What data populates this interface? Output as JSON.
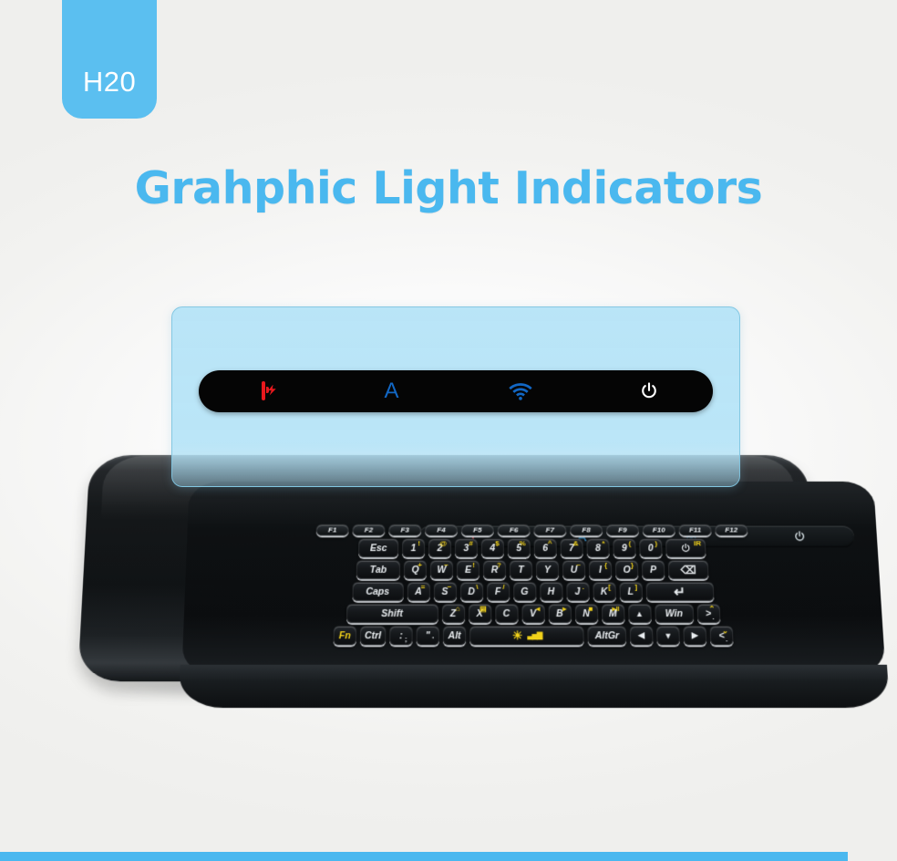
{
  "page": {
    "background": "#f4f4f2",
    "accent": "#4ab8ef",
    "badge_color": "#5bbff0"
  },
  "badge": {
    "label": "H20"
  },
  "heading": {
    "title": "Grahphic Light Indicators",
    "color": "#4ab8ef"
  },
  "indicators": {
    "items": [
      {
        "name": "battery-charging-icon",
        "label": "Battery Charging",
        "color": "#e8181d",
        "type": "battery"
      },
      {
        "name": "caps-lock-icon",
        "label": "A",
        "color": "#1267c4",
        "type": "caps"
      },
      {
        "name": "wifi-icon",
        "label": "Wi-Fi",
        "color": "#1267c4",
        "type": "wifi"
      },
      {
        "name": "power-icon",
        "label": "Power",
        "color": "#ffffff",
        "type": "power"
      }
    ],
    "strip_items": [
      {
        "name": "battery-charging-icon",
        "color": "#d4565e",
        "type": "battery"
      },
      {
        "name": "caps-lock-icon",
        "label": "A",
        "color": "#3f9ad4",
        "type": "caps"
      },
      {
        "name": "wifi-icon",
        "color": "#3f9ad4",
        "type": "wifi"
      },
      {
        "name": "power-icon",
        "color": "#dfe9ee",
        "type": "power"
      }
    ]
  },
  "keyboard": {
    "function_row": [
      "F1",
      "F2",
      "F3",
      "F4",
      "F5",
      "F6",
      "F7",
      "F8",
      "F9",
      "F10",
      "F11",
      "F12"
    ],
    "rows": [
      {
        "name": "number-row",
        "keys": [
          {
            "main": "Esc",
            "width": "wide-esc"
          },
          {
            "main": "1",
            "sup": "!"
          },
          {
            "main": "2",
            "sup": "@"
          },
          {
            "main": "3",
            "sup": "#"
          },
          {
            "main": "4",
            "sup": "$"
          },
          {
            "main": "5",
            "sup": "%"
          },
          {
            "main": "6",
            "sup": "^"
          },
          {
            "main": "7",
            "sup": "&"
          },
          {
            "main": "8",
            "sup": "*"
          },
          {
            "main": "9",
            "sup": "("
          },
          {
            "main": "0",
            "sup": ")"
          },
          {
            "icon": "power",
            "sup": "IR",
            "width": "wide-bksp"
          }
        ]
      },
      {
        "name": "qwerty-row",
        "keys": [
          {
            "main": "Tab",
            "width": "wide-tab"
          },
          {
            "main": "Q",
            "sup": "+"
          },
          {
            "main": "W",
            "sup": "−"
          },
          {
            "main": "E",
            "sup": "!"
          },
          {
            "main": "R",
            "sup": "?"
          },
          {
            "main": "T"
          },
          {
            "main": "Y"
          },
          {
            "main": "U",
            "sup": "~"
          },
          {
            "main": "I",
            "sup": "{"
          },
          {
            "main": "O",
            "sup": "}"
          },
          {
            "main": "P"
          },
          {
            "icon": "backspace",
            "width": "wide-bksp"
          }
        ]
      },
      {
        "name": "home-row",
        "keys": [
          {
            "main": "Caps",
            "width": "wide-caps"
          },
          {
            "main": "A",
            "sup": "="
          },
          {
            "main": "S",
            "sup": "−"
          },
          {
            "main": "D",
            "sup": "\\"
          },
          {
            "main": "F",
            "sup": "/"
          },
          {
            "main": "G"
          },
          {
            "main": "H"
          },
          {
            "main": "J",
            "sup": "."
          },
          {
            "main": "K",
            "sup": "["
          },
          {
            "main": "L",
            "sup": "]"
          },
          {
            "icon": "enter",
            "width": "wide-enter"
          }
        ]
      },
      {
        "name": "shift-row",
        "keys": [
          {
            "main": "Shift",
            "width": "wide-shift"
          },
          {
            "main": "Z",
            "sup": "⌂"
          },
          {
            "main": "X",
            "sup": "▤"
          },
          {
            "main": "C"
          },
          {
            "main": "V",
            "sup": "◂"
          },
          {
            "main": "B",
            "sup": "▸"
          },
          {
            "main": "N",
            "sup": "■"
          },
          {
            "main": "M",
            "sup": "▸‖"
          },
          {
            "icon": "arrow-up"
          },
          {
            "main": "Win",
            "width": "wide-win"
          },
          {
            "main": ">",
            "sub": ".",
            "sup": "⌃",
            "width": "narrow"
          }
        ]
      },
      {
        "name": "bottom-row",
        "keys": [
          {
            "main": "Fn",
            "yellow": true
          },
          {
            "main": "Ctrl"
          },
          {
            "main": ":",
            "sub": ";"
          },
          {
            "main": "\"",
            "sub": "'"
          },
          {
            "main": "Alt"
          },
          {
            "icon": "space-brightness",
            "width": "wide-space"
          },
          {
            "main": "AltGr",
            "width": "wide-altgr"
          },
          {
            "icon": "arrow-left"
          },
          {
            "icon": "arrow-down"
          },
          {
            "icon": "arrow-right"
          },
          {
            "main": "<",
            "sub": ".",
            "sup": "⌄",
            "width": "narrow"
          }
        ]
      }
    ]
  }
}
